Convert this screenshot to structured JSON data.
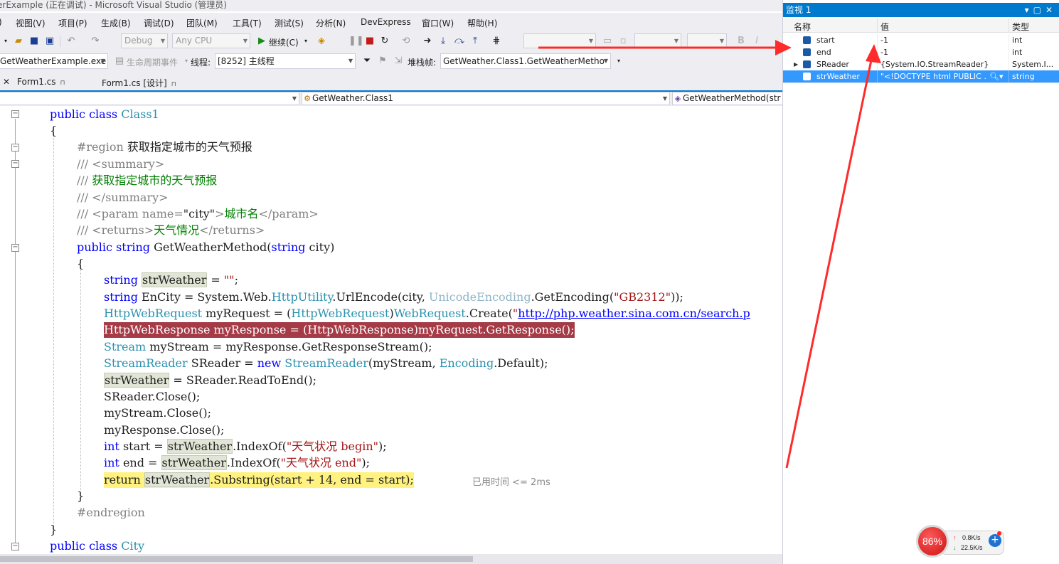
{
  "window": {
    "title": "erExample (正在调试) - Microsoft Visual Studio (管理员)"
  },
  "menu": {
    "items": [
      ")",
      "视图(V)",
      "项目(P)",
      "生成(B)",
      "调试(D)",
      "团队(M)",
      "工具(T)",
      "测试(S)",
      "分析(N)",
      "DevExpress",
      "窗口(W)",
      "帮助(H)"
    ]
  },
  "toolbar": {
    "config": "Debug",
    "platform": "Any CPU",
    "continue_label": "继续(C)",
    "process": "GetWeatherExample.exe",
    "lifecycle_label": "生命周期事件",
    "thread_label": "线程:",
    "thread_value": "[8252] 主线程",
    "stackframe_label": "堆栈帧:",
    "stackframe_value": "GetWeather.Class1.GetWeatherMetho"
  },
  "tabs": [
    {
      "label": "Form1.cs"
    },
    {
      "label": "Form1.cs [设计]"
    }
  ],
  "navbar": {
    "class_combo": "GetWeather.Class1",
    "member_combo": "GetWeatherMethod(str"
  },
  "code": {
    "l1_kw1": "public",
    "l1_kw2": "class",
    "l1_name": "Class1",
    "l2": "{",
    "l3_kw": "#region",
    "l3_text": "获取指定城市的天气预报",
    "l4_a": "/// ",
    "l4_b": "<summary>",
    "l5_a": "/// ",
    "l5_b": "获取指定城市的天气预报",
    "l6_a": "/// ",
    "l6_b": "</summary>",
    "l7_a": "/// ",
    "l7_b": "<param name=",
    "l7_c": "\"city\"",
    "l7_d": ">",
    "l7_e": "城市名",
    "l7_f": "</param>",
    "l8_a": "/// ",
    "l8_b": "<returns>",
    "l8_c": "天气情况",
    "l8_d": "</returns>",
    "l9_kw1": "public",
    "l9_kw2": "string",
    "l9_name": "GetWeatherMethod(",
    "l9_kw3": "string",
    "l9_rest": " city)",
    "l10": "{",
    "l11_kw": "string",
    "l11_var": "strWeather",
    "l11_eq": " = ",
    "l11_str": "\"\"",
    "l11_end": ";",
    "l12_kw": "string",
    "l12_a": " EnCity = System.Web.",
    "l12_ty": "HttpUtility",
    "l12_b": ".UrlEncode(city, ",
    "l12_ty2": "UnicodeEncoding",
    "l12_c": ".GetEncoding(",
    "l12_str": "\"GB2312\"",
    "l12_d": "));",
    "l13_ty": "HttpWebRequest",
    "l13_a": " myRequest = (",
    "l13_ty2": "HttpWebRequest",
    "l13_b": ")",
    "l13_ty3": "WebRequest",
    "l13_c": ".Create(",
    "l13_str": "\"",
    "l13_url": "http://php.weather.sina.com.cn/search.p",
    "l14": "HttpWebResponse myResponse = (HttpWebResponse)myRequest.GetResponse();",
    "l15_ty": "Stream",
    "l15_rest": " myStream = myResponse.GetResponseStream();",
    "l16_ty": "StreamReader",
    "l16_a": " SReader = ",
    "l16_kw": "new",
    "l16_ty2": "StreamReader",
    "l16_b": "(myStream, ",
    "l16_ty3": "Encoding",
    "l16_c": ".Default);",
    "l17_var": "strWeather",
    "l17_rest": " = SReader.ReadToEnd();",
    "l18": "SReader.Close();",
    "l19": "myStream.Close();",
    "l20": "myResponse.Close();",
    "l21_kw": "int",
    "l21_a": " start = ",
    "l21_var": "strWeather",
    "l21_b": ".IndexOf(",
    "l21_str": "\"天气状况 begin\"",
    "l21_c": ");",
    "l22_kw": "int",
    "l22_a": " end = ",
    "l22_var": "strWeather",
    "l22_b": ".IndexOf(",
    "l22_str": "\"天气状况 end\"",
    "l22_c": ");",
    "l23_kw": "return",
    "l23_var": "strWeather",
    "l23_rest": ".Substring(start + 14, end = start);",
    "l23_perf": "已用时间 <= 2ms",
    "l24": "}",
    "l25": "#endregion",
    "l26": "}",
    "l27_kw1": "public",
    "l27_kw2": "class",
    "l27_name": "City"
  },
  "watch": {
    "title": "监视 1",
    "col_name": "名称",
    "col_value": "值",
    "col_type": "类型",
    "rows": [
      {
        "name": "start",
        "value": "-1",
        "type": "int"
      },
      {
        "name": "end",
        "value": "-1",
        "type": "int"
      },
      {
        "name": "SReader",
        "value": "{System.IO.StreamReader}",
        "type": "System.I..."
      },
      {
        "name": "strWeather",
        "value": "\"<!DOCTYPE html PUBLIC ...",
        "type": "string"
      }
    ]
  },
  "network": {
    "percent": "86%",
    "upload": "0.8K/s",
    "download": "22.5K/s"
  },
  "colors": {
    "accent": "#007acc",
    "current_statement": "#a53b46",
    "return_highlight": "#fff281",
    "annotation_arrow": "#ff2a2a"
  }
}
